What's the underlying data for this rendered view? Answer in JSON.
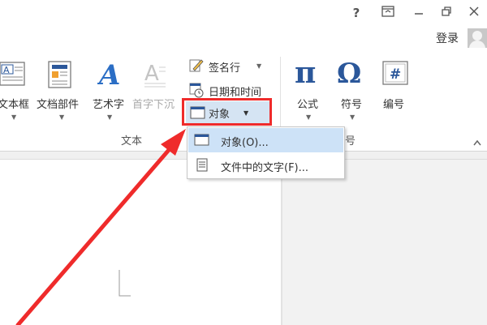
{
  "window": {
    "help_glyph": "?",
    "login_label": "登录"
  },
  "ribbon": {
    "text_group": {
      "label": "文本",
      "textbox_label": "文本框",
      "quickparts_label": "文档部件",
      "wordart_label": "艺术字",
      "dropcap_label": "首字下沉",
      "signature_label": "签名行",
      "datetime_label": "日期和时间",
      "object_label": "对象"
    },
    "symbols_group": {
      "label": "符号",
      "equation_label": "公式",
      "symbol_label": "符号",
      "number_label": "编号"
    }
  },
  "object_menu": {
    "items": [
      {
        "label": "对象(O)..."
      },
      {
        "label": "文件中的文字(F)..."
      }
    ]
  },
  "colors": {
    "accent": "#2b579a",
    "highlight": "#cde2f7",
    "annotation_red": "#ef2b2b"
  }
}
